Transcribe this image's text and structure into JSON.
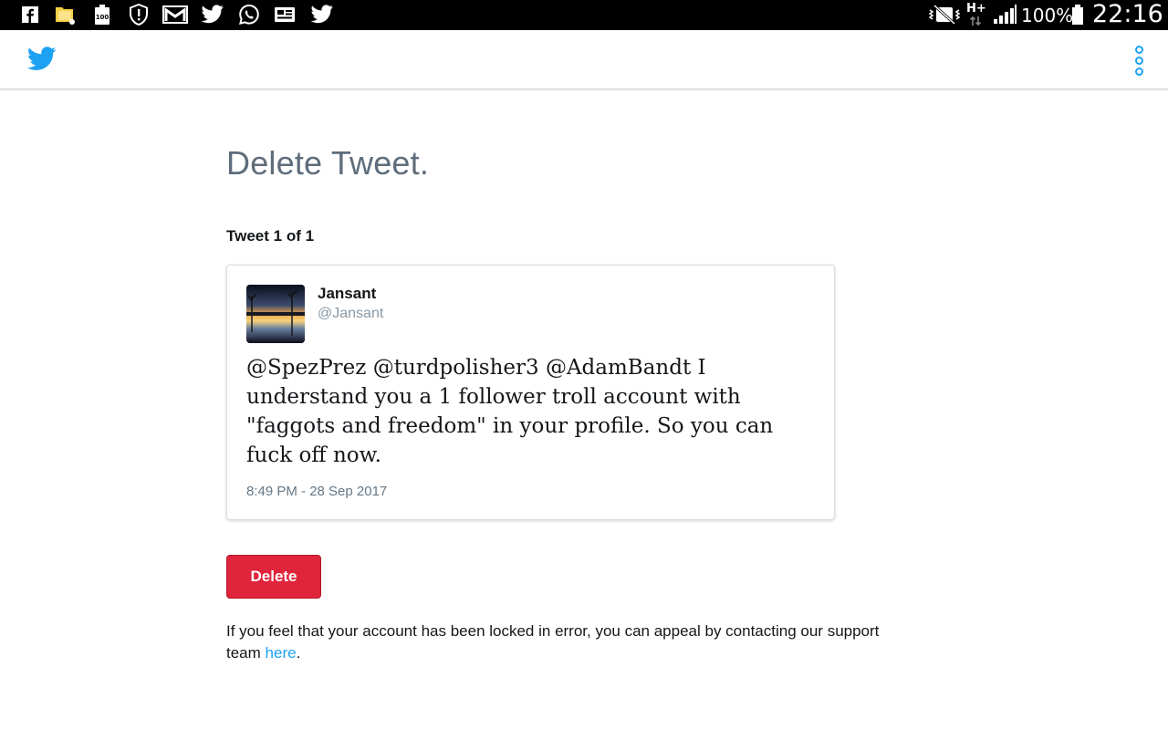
{
  "status_bar": {
    "notification_icons": [
      "facebook-icon",
      "file-manager-icon",
      "battery-monitor-icon",
      "alert-icon",
      "gmail-icon",
      "twitter-icon",
      "whatsapp-icon",
      "news-icon",
      "twitter-icon"
    ],
    "network_type": "H+",
    "battery_percent": "100%",
    "time": "22:16"
  },
  "app_bar": {
    "logo_icon": "twitter-bird-icon",
    "menu_icon": "overflow-menu-icon",
    "accent_color": "#1da1f2"
  },
  "page": {
    "title": "Delete Tweet.",
    "counter": "Tweet 1 of 1"
  },
  "tweet": {
    "display_name": "Jansant",
    "screen_name": "@Jansant",
    "text": "@SpezPrez @turdpolisher3 @AdamBandt I understand you a 1 follower troll account with \"faggots and freedom\" in your profile. So you can fuck off now.",
    "timestamp": "8:49 PM - 28 Sep 2017"
  },
  "actions": {
    "delete_label": "Delete",
    "delete_color": "#e0243b"
  },
  "appeal": {
    "text": "If you feel that your account has been locked in error, you can appeal by contacting our support team ",
    "link_label": "here",
    "suffix": "."
  }
}
